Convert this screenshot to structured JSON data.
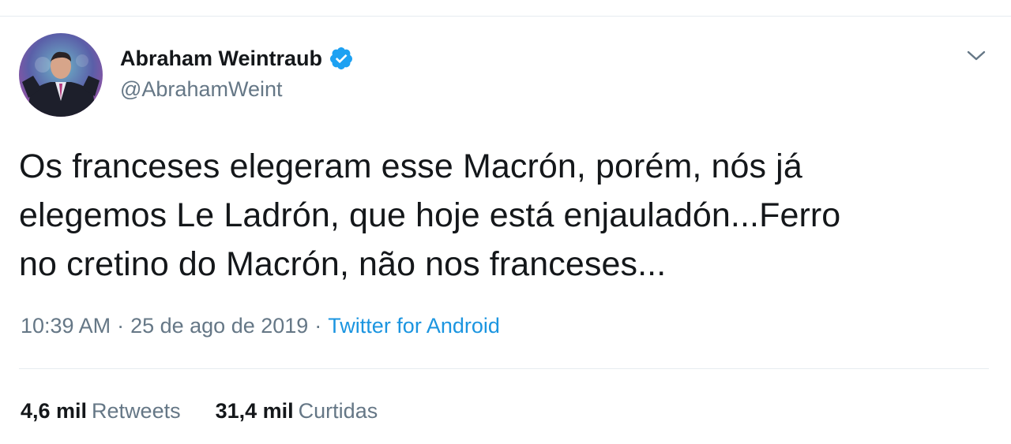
{
  "colors": {
    "text": "#14171a",
    "secondary": "#657786",
    "link": "#1b95e0",
    "verified": "#1da1f2",
    "divider": "#e6ecf0"
  },
  "author": {
    "display_name": "Abraham Weintraub",
    "handle": "@AbrahamWeint",
    "verified_icon": "verified-badge-icon",
    "avatar_icon": "profile-photo"
  },
  "menu": {
    "icon": "chevron-down-icon"
  },
  "tweet": {
    "lines": [
      "Os franceses elegeram esse Macrón, porém, nós já",
      "elegemos Le Ladrón, que hoje está enjauladón...Ferro",
      "no cretino do Macrón, não nos franceses..."
    ]
  },
  "meta": {
    "time": "10:39 AM",
    "separator": "·",
    "date": "25 de ago de 2019",
    "source": "Twitter for Android"
  },
  "stats": {
    "retweets_count": "4,6 mil",
    "retweets_label": "Retweets",
    "likes_count": "31,4 mil",
    "likes_label": "Curtidas"
  }
}
